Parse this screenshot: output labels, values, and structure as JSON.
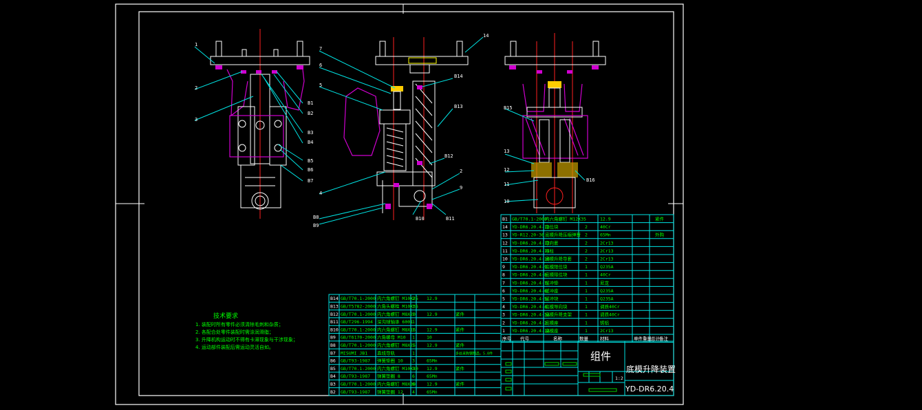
{
  "tech_req": {
    "title": "技术要求",
    "lines": [
      "1. 装配时所有零件必须清除毛刺和杂质；",
      "2. 各配合处零件装配时需涂润滑脂；",
      "3. 升降机构运动时不得有卡滞现象与干涉现象；",
      "4. 运动部件装配后需运动灵活自如。"
    ]
  },
  "drawing_title": "底模升降装置",
  "assembly_label": "组件",
  "drawing_number": "YD-DR6.20.4",
  "scale": "1:2",
  "callouts": {
    "view1": [
      "1",
      "2",
      "3",
      "B1",
      "B2",
      "B3",
      "B4",
      "B5",
      "B6",
      "B7"
    ],
    "view2": [
      "7",
      "6",
      "5",
      "4",
      "B8",
      "B9",
      "B10",
      "B11",
      "B14",
      "B13",
      "B12",
      "2",
      "9",
      "14"
    ],
    "view3": [
      "B15",
      "13",
      "12",
      "11",
      "10",
      "B16"
    ]
  },
  "bom_right": {
    "header": [
      "序号",
      "代号",
      "名称",
      "数量",
      "材料",
      "单件重量",
      "总计",
      "备注"
    ],
    "rows": [
      [
        "B1",
        "GB/T70.1-2000",
        "内六角螺钉 M12X35",
        "",
        "12.9",
        "",
        "",
        "紧件"
      ],
      [
        "14",
        "YD-DR6.20.4-13",
        "定位块",
        "2",
        "40Cr",
        "",
        "",
        ""
      ],
      [
        "13",
        "YD-R12.20-36",
        "底模升降压缩弹簧",
        "2",
        "65Mn",
        "",
        "",
        "外购"
      ],
      [
        "12",
        "YD-DR6.20.4-12",
        "导向套",
        "2",
        "2Cr13",
        "",
        "",
        ""
      ],
      [
        "11",
        "YD-DR6.20.4-11",
        "导柱",
        "2",
        "2Cr13",
        "",
        "",
        ""
      ],
      [
        "10",
        "YD-DR6.20.4-10",
        "底模升降导套",
        "2",
        "2Cr13",
        "",
        "",
        ""
      ],
      [
        "9",
        "YD-DR6.20.4-9",
        "底模限位块",
        "1",
        "Q235A",
        "",
        "",
        ""
      ],
      [
        "8",
        "YD-DR6.20.4-8",
        "底模限位块",
        "1",
        "40Cr",
        "",
        "",
        ""
      ],
      [
        "7",
        "YD-DR6.20.4-7",
        "缓冲垫",
        "1",
        "尼龙",
        "",
        "",
        ""
      ],
      [
        "6",
        "YD-DR6.20.4-6",
        "缓冲座",
        "1",
        "Q235A",
        "",
        "",
        ""
      ],
      [
        "5",
        "YD-DR6.20.4-5",
        "缓冲块",
        "1",
        "Q235A",
        "",
        "",
        ""
      ],
      [
        "4",
        "YD-DR6.20.4-4",
        "底模导向块",
        "1",
        "调质40Cr",
        "",
        "",
        ""
      ],
      [
        "3",
        "YD-DR6.20.4-3A",
        "底模升降支架",
        "1",
        "调质40Cr",
        "",
        "",
        ""
      ],
      [
        "2",
        "YD-DR6.20.4-2",
        "底模座",
        "1",
        "铸铝",
        "",
        "",
        ""
      ],
      [
        "1",
        "YD-DR6.20.4-1A",
        "底模座",
        "1",
        "2Cr13",
        "",
        "",
        ""
      ]
    ]
  },
  "bom_left": {
    "rows": [
      [
        "B14",
        "GB/T70.1-2000",
        "内六角螺钉 M10X25",
        "2",
        "12.9",
        "",
        ""
      ],
      [
        "B13",
        "GB/T5782-2000",
        "六角头螺栓 M10X35",
        "1",
        "",
        "",
        ""
      ],
      [
        "B12",
        "GB/T70.1-2000",
        "内六角螺钉 M8X20",
        "1",
        "12.9",
        "紧件",
        ""
      ],
      [
        "B11",
        "GB/T296-1994",
        "深沟球轴承 6001",
        "1",
        "",
        "",
        ""
      ],
      [
        "B10",
        "GB/T70.1-2000",
        "内六角螺钉 M8X16",
        "1",
        "12.9",
        "紧件",
        ""
      ],
      [
        "B9",
        "GB/T6170-2000",
        "六角螺母 M10",
        "1",
        "10",
        "",
        ""
      ],
      [
        "B8",
        "GB/T70.1-2000",
        "内六角螺钉 M8X25",
        "1",
        "12.9",
        "紧件",
        ""
      ],
      [
        "B7",
        "MISUMI JB1",
        "直线导轨",
        "1",
        "",
        "多处采购钢制品，5.0件",
        ""
      ],
      [
        "B6",
        "GB/T93-1987",
        "弹簧垫圈 10",
        "3",
        "65Mn",
        "",
        ""
      ],
      [
        "B5",
        "GB/T70.1-2000",
        "内六角螺钉 M10X30",
        "3",
        "12.9",
        "紧件",
        ""
      ],
      [
        "B4",
        "GB/T93-1987",
        "弹簧垫圈 8",
        "6",
        "65Mn",
        "",
        ""
      ],
      [
        "B3",
        "GB/T70.1-2000",
        "内六角螺钉 M8X20",
        "6",
        "12.9",
        "紧件",
        ""
      ],
      [
        "B2",
        "GB/T93-1987",
        "弹簧垫圈 12",
        "4",
        "65Mn",
        "",
        ""
      ]
    ]
  }
}
